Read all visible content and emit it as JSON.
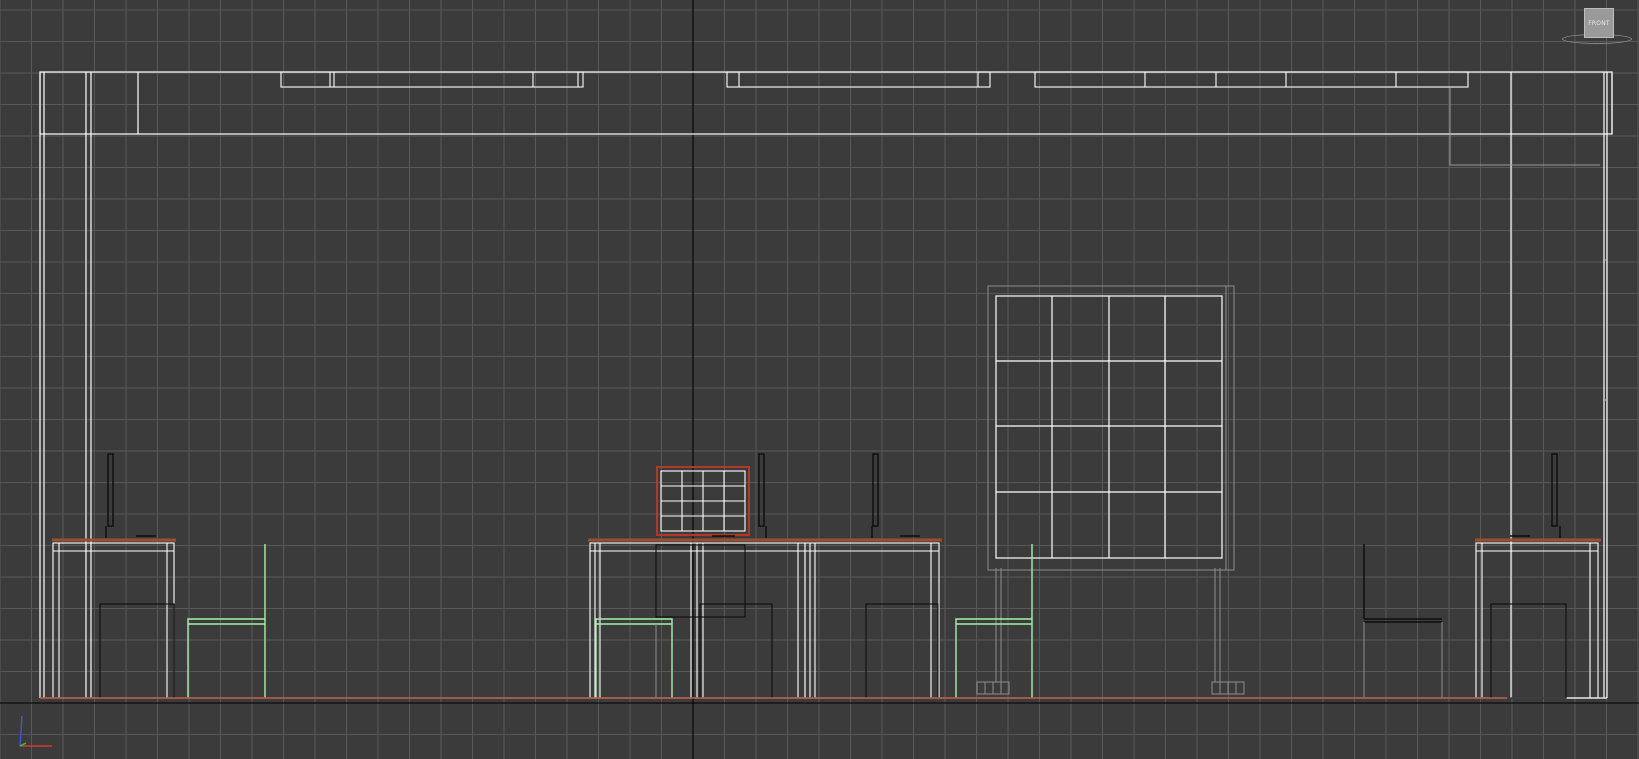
{
  "viewport": {
    "view_label": "FRONT",
    "background_color": "#3b3b3b",
    "grid_color": "#585858",
    "world_axis_color": "#0d0d0d",
    "wireframe_color": "#ffffff",
    "chair_color": "#a8f0a8",
    "selection_color": "#c0392b",
    "floor_color": "#b5503a",
    "desk_top_color": "#9c4f2e"
  },
  "navigation": {
    "viewcube_icon": "viewcube-icon",
    "axis_icon": "axis-tripod-icon"
  },
  "axis_tripod": {
    "x_color": "#d23b2b",
    "y_color": "#3bbf3b",
    "z_color": "#3b5bd2"
  }
}
